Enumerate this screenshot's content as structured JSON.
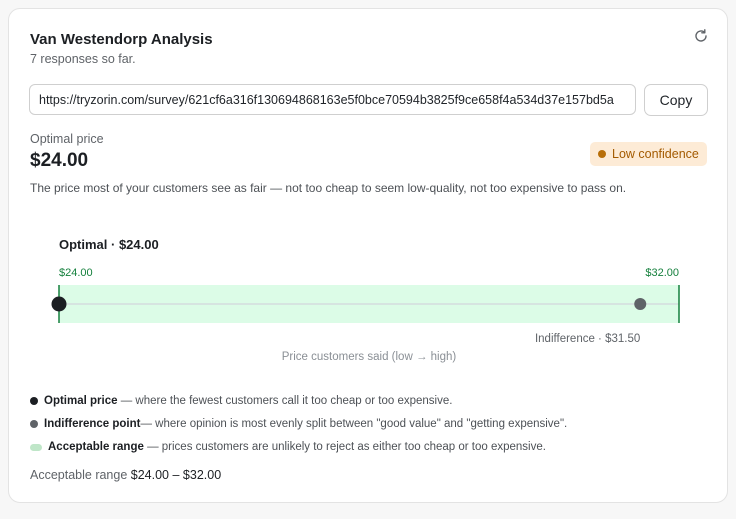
{
  "header": {
    "title": "Van Westendorp Analysis",
    "subtitle": "7 responses so far.",
    "refresh_icon": "refresh-icon"
  },
  "share": {
    "url": "https://tryzorin.com/survey/621cf6a316f130694868163e5f0bce70594b3825f9ce658f4a534d37e157bd5a",
    "copy_label": "Copy"
  },
  "optimal": {
    "label": "Optimal price",
    "value": "$24.00",
    "badge": "Low confidence",
    "description": "The price most of your customers see as fair — not too cheap to seem low-quality, not too expensive to pass on."
  },
  "chart_data": {
    "type": "range",
    "title": "Optimal · $24.00",
    "xlabel": "Price customers said (low → high)",
    "range": {
      "min": 24.0,
      "max": 32.0,
      "min_label": "$24.00",
      "max_label": "$32.00"
    },
    "points": [
      {
        "name": "Optimal",
        "value": 24.0
      },
      {
        "name": "Indifference",
        "value": 31.5,
        "label": "Indifference · $31.50"
      }
    ],
    "colors": {
      "range_fill": "#dcfce7",
      "range_edge": "#15803d",
      "optimal": "#1c1f23",
      "indifference": "#5f6368"
    }
  },
  "legend": [
    {
      "title": "Optimal price",
      "text": " — where the fewest customers call it too cheap or too expensive."
    },
    {
      "title": "Indifference point",
      "text": "— where opinion is most evenly split between \"good value\" and \"getting expensive\"."
    },
    {
      "title": "Acceptable range",
      "text": " — prices customers are unlikely to reject as either too cheap or too expensive."
    }
  ],
  "summary": {
    "label": "Acceptable range",
    "value": "$24.00 – $32.00"
  }
}
